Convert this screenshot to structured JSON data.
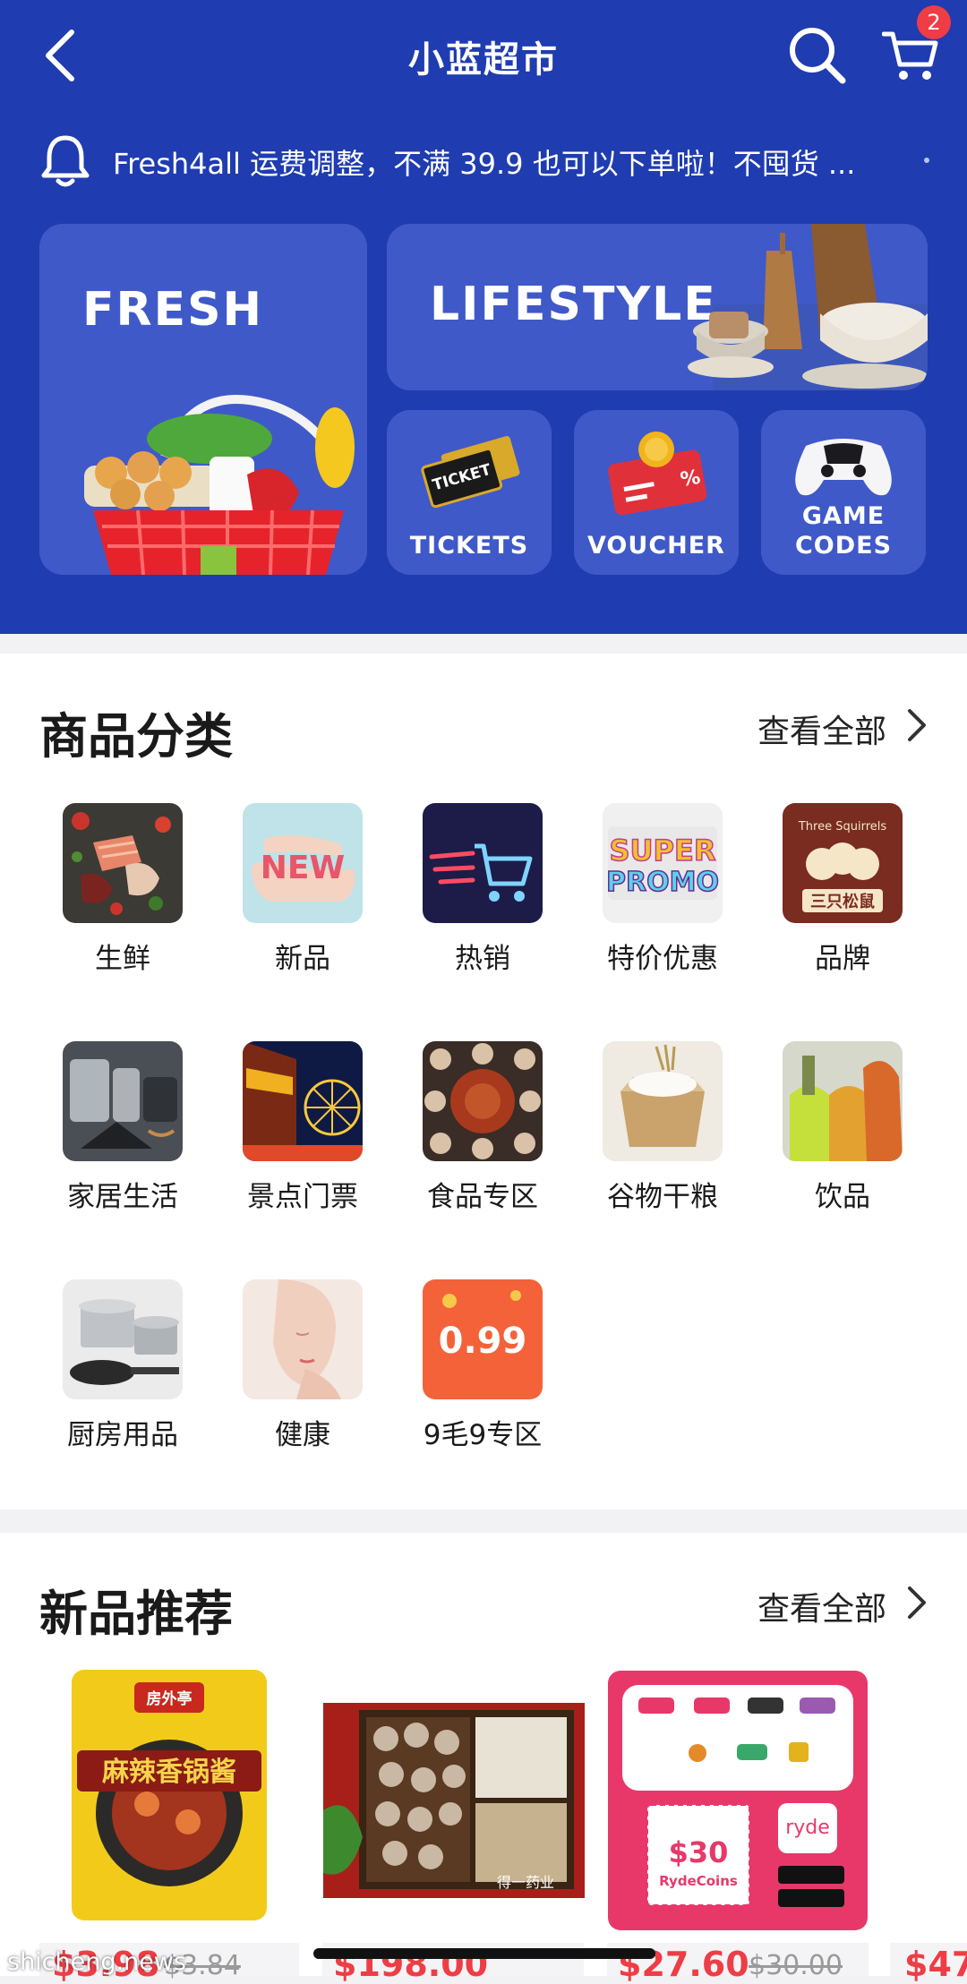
{
  "nav": {
    "title": "小蓝超市",
    "cart_count": "2"
  },
  "notice": {
    "text": "Fresh4all 运费调整，不满 39.9 也可以下单啦！不囤货 ..."
  },
  "banners": {
    "fresh": "FRESH",
    "lifestyle": "LIFESTYLE",
    "tickets": "TICKETS",
    "ticket_stub": "TICKET",
    "voucher": "VOUCHER",
    "voucher_mark": "%",
    "game_line1": "GAME",
    "game_line2": "CODES"
  },
  "categories_section": {
    "title": "商品分类",
    "see_all": "查看全部",
    "items": [
      {
        "label": "生鲜"
      },
      {
        "label": "新品",
        "img_text": "NEW"
      },
      {
        "label": "热销"
      },
      {
        "label": "特价优惠",
        "img_text": "SUPER PROMO"
      },
      {
        "label": "品牌",
        "img_text": "三只松鼠",
        "img_sub": "Three Squirrels"
      },
      {
        "label": "家居生活"
      },
      {
        "label": "景点门票"
      },
      {
        "label": "食品专区"
      },
      {
        "label": "谷物干粮"
      },
      {
        "label": "饮品"
      },
      {
        "label": "厨房用品"
      },
      {
        "label": "健康"
      },
      {
        "label": "9毛9专区",
        "img_text": "0.99"
      }
    ]
  },
  "new_section": {
    "title": "新品推荐",
    "see_all": "查看全部",
    "products": [
      {
        "price": "$3.98",
        "old_price": "$3.84",
        "img_text": "麻辣香锅酱",
        "brand": "房外亭"
      },
      {
        "price": "$198.00",
        "old_price": "",
        "img_text": "得一药业"
      },
      {
        "price": "$27.60",
        "old_price": "$30.00",
        "img_text": "$30",
        "img_sub": "RydeCoins",
        "brand": "ryde"
      },
      {
        "price": "$47",
        "old_price": ""
      }
    ]
  },
  "watermark": "shicheng.news",
  "colors": {
    "hero_bg": "#1f3cb0",
    "card_bg": "#4059c8",
    "price_red": "#ef3d45",
    "ryde_pink": "#e8386a"
  }
}
